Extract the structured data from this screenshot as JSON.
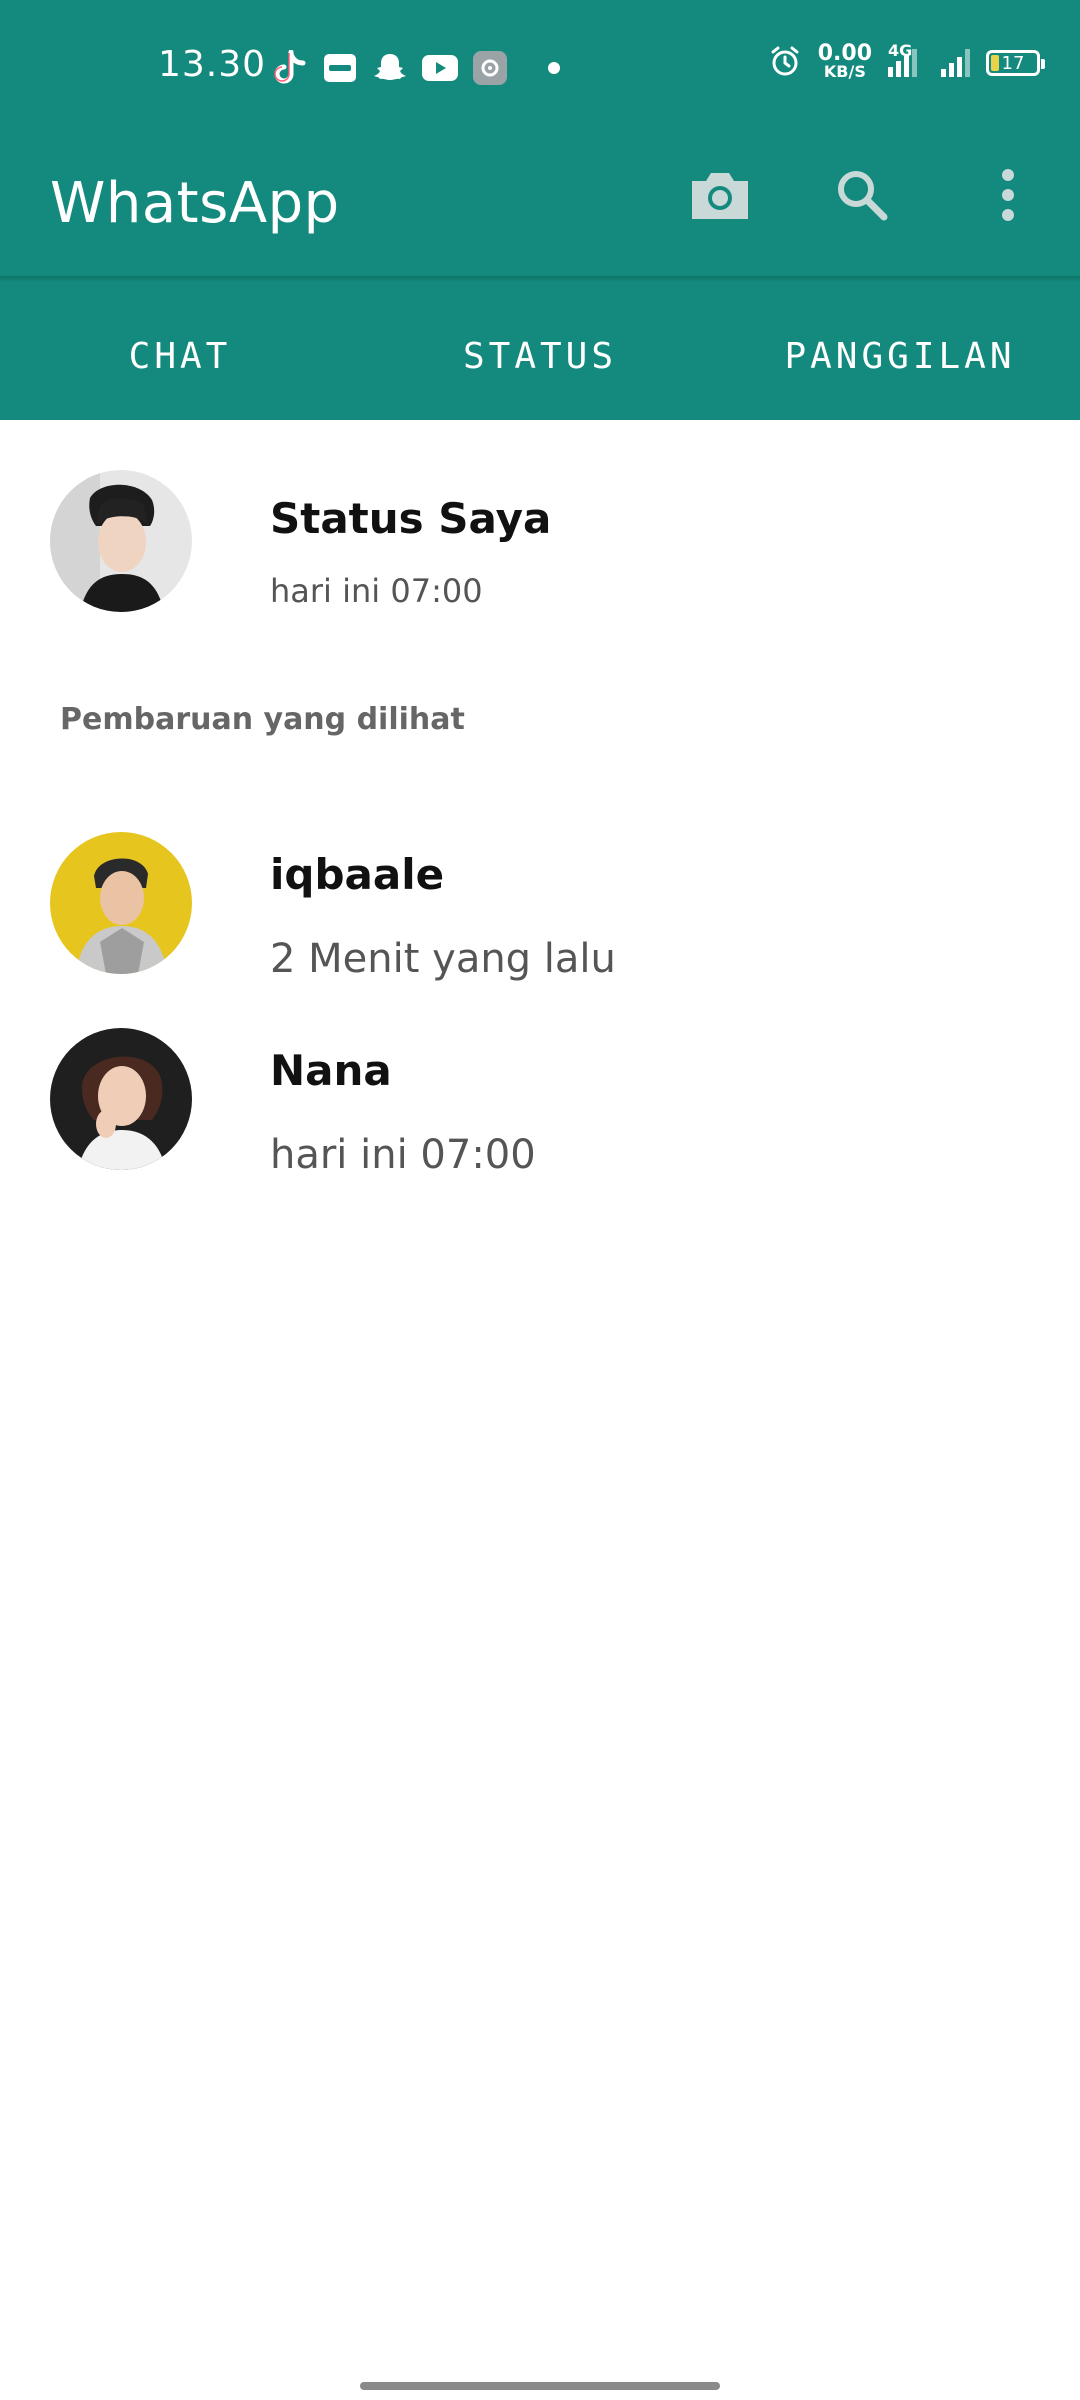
{
  "status_bar": {
    "time": "13.30",
    "app_icons": [
      "tiktok-icon",
      "dana-icon",
      "snapchat-icon",
      "youtube-icon",
      "settings-icon"
    ],
    "speed_value": "0.00",
    "speed_unit": "KB/S",
    "network": "4G",
    "battery_level": "17"
  },
  "app_bar": {
    "title": "WhatsApp",
    "icons": [
      "camera-icon",
      "search-icon",
      "more-vert-icon"
    ]
  },
  "tabs": [
    {
      "label": "CHAT"
    },
    {
      "label": "STATUS"
    },
    {
      "label": "PANGGILAN"
    }
  ],
  "my_status": {
    "name": "Status Saya",
    "time": "hari ini 07:00"
  },
  "section_label": "Pembaruan yang dilihat",
  "updates": [
    {
      "name": "iqbaale",
      "time": "2 Menit yang lalu"
    },
    {
      "name": "Nana",
      "time": "hari ini 07:00"
    }
  ],
  "colors": {
    "primary": "#138a7d",
    "text_primary": "#111111",
    "text_secondary": "#555555"
  }
}
